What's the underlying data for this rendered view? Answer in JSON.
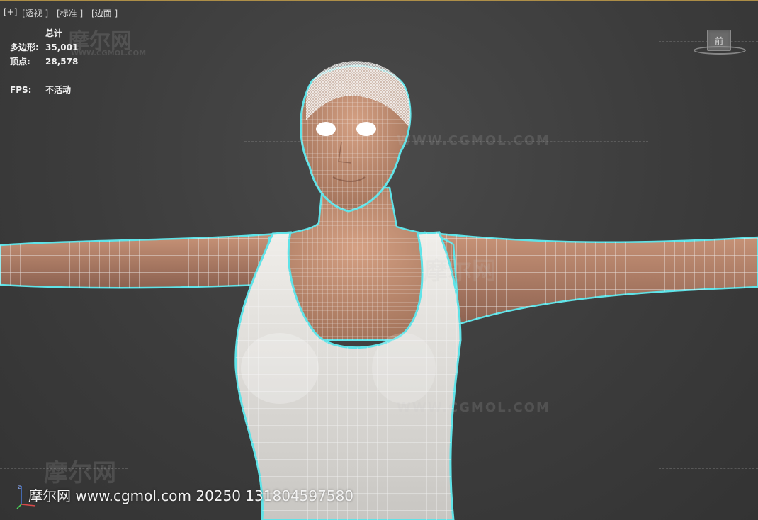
{
  "viewport": {
    "label_plus": "[+]",
    "label_view": "[透视 ]",
    "label_shading": "[标准 ]",
    "label_edges": "[边面 ]"
  },
  "stats": {
    "header": "总计",
    "polygons_label": "多边形:",
    "polygons_value": "35,001",
    "vertices_label": "顶点:",
    "vertices_value": "28,578",
    "fps_label": "FPS:",
    "fps_value": "不活动"
  },
  "viewcube": {
    "face_label": "前"
  },
  "watermarks": {
    "logo_text": "摩尔网",
    "url_text": "WWW.CGMOL.COM"
  },
  "footer": {
    "text": "摩尔网 www.cgmol.com 20250   131804597580"
  },
  "colors": {
    "selection_outline": "#5fe3e8",
    "skin": "#c9967a",
    "tank_top": "#e8e6e2",
    "background": "#3c3c3c"
  },
  "icons": {
    "axis": "axis-tripod-icon"
  }
}
